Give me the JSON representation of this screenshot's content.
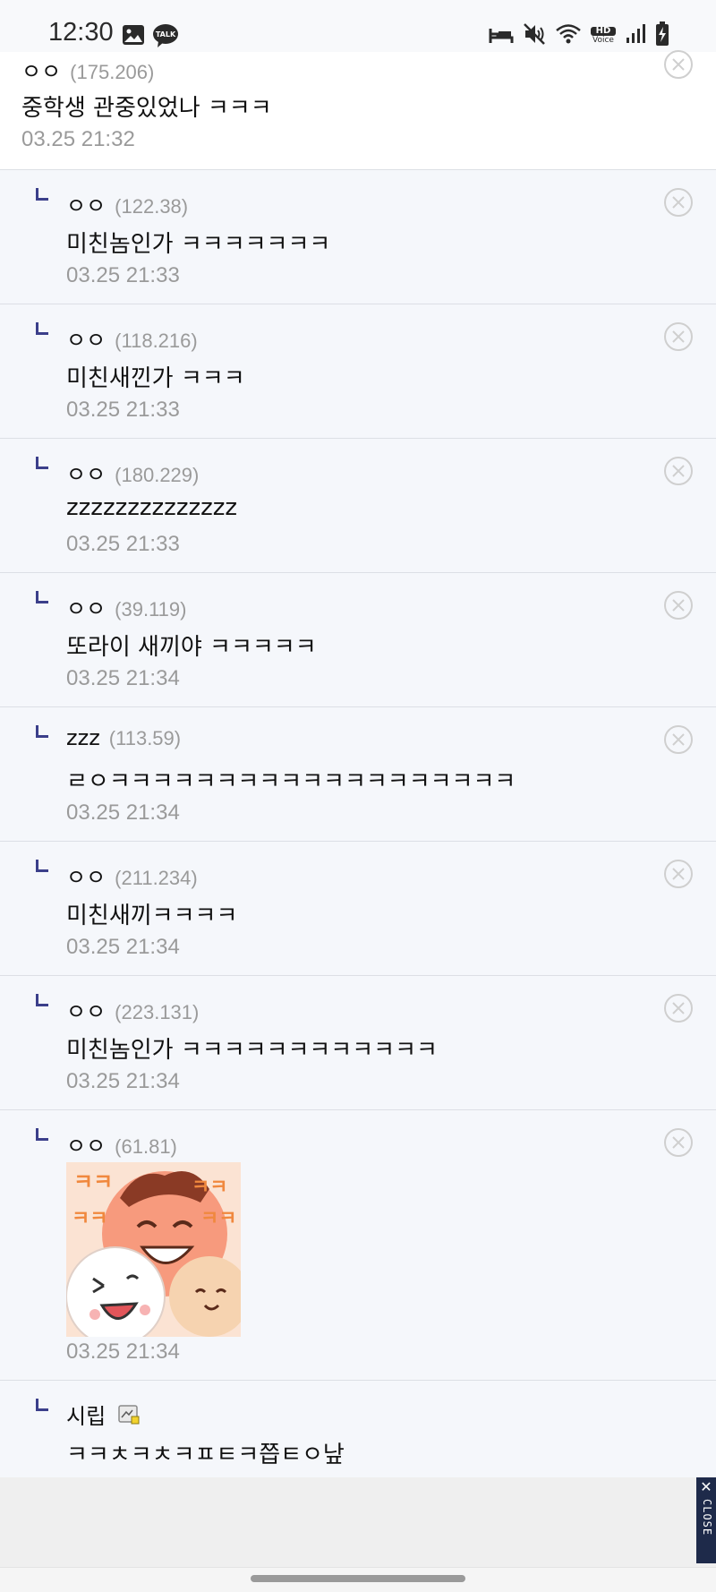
{
  "status_bar": {
    "time": "12:30",
    "left_icons": [
      "image-icon",
      "kakaotalk-icon"
    ],
    "talk_badge": "TALK",
    "right_icons": [
      "sleep-mode-icon",
      "mute-icon",
      "wifi-icon",
      "hd-voice-icon",
      "signal-icon",
      "battery-charging-icon"
    ],
    "hd_label": "HD",
    "voice_label": "Voice"
  },
  "comments": [
    {
      "nick": "ㅇㅇ",
      "ip": "(175.206)",
      "body": "중학생 관중있었나 ㅋㅋㅋ",
      "date": "03.25 21:32",
      "reply": false
    },
    {
      "nick": "ㅇㅇ",
      "ip": "(122.38)",
      "body": "미친놈인가 ㅋㅋㅋㅋㅋㅋㅋ",
      "date": "03.25 21:33",
      "reply": true
    },
    {
      "nick": "ㅇㅇ",
      "ip": "(118.216)",
      "body": "미친새낀가 ㅋㅋㅋ",
      "date": "03.25 21:33",
      "reply": true
    },
    {
      "nick": "ㅇㅇ",
      "ip": "(180.229)",
      "body": "zzzzzzzzzzzzzz",
      "date": "03.25 21:33",
      "reply": true
    },
    {
      "nick": "ㅇㅇ",
      "ip": "(39.119)",
      "body": "또라이 새끼야 ㅋㅋㅋㅋㅋ",
      "date": "03.25 21:34",
      "reply": true
    },
    {
      "nick": "zzz",
      "ip": "(113.59)",
      "body": "ㄹㅇㅋㅋㅋㅋㅋㅋㅋㅋㅋㅋㅋㅋㅋㅋㅋㅋㅋㅋㅋ",
      "date": "03.25 21:34",
      "reply": true
    },
    {
      "nick": "ㅇㅇ",
      "ip": "(211.234)",
      "body": "미친새끼ㅋㅋㅋㅋ",
      "date": "03.25 21:34",
      "reply": true
    },
    {
      "nick": "ㅇㅇ",
      "ip": "(223.131)",
      "body": "미친놈인가 ㅋㅋㅋㅋㅋㅋㅋㅋㅋㅋㅋㅋ",
      "date": "03.25 21:34",
      "reply": true
    },
    {
      "nick": "ㅇㅇ",
      "ip": "(61.81)",
      "body": "",
      "date": "03.25 21:34",
      "reply": true,
      "sticker": true
    },
    {
      "nick": "시립",
      "ip": "",
      "body": "ㅋㅋㅊㅋㅊㅋㅍㅌㅋ쯥ㅌㅇ낲",
      "date": "",
      "reply": true,
      "member_icon": "gallery-member-icon"
    }
  ],
  "sticker": {
    "text": "ㅋㅋ"
  },
  "ad": {
    "close_x": "✕",
    "close_label": "CLOSE"
  }
}
